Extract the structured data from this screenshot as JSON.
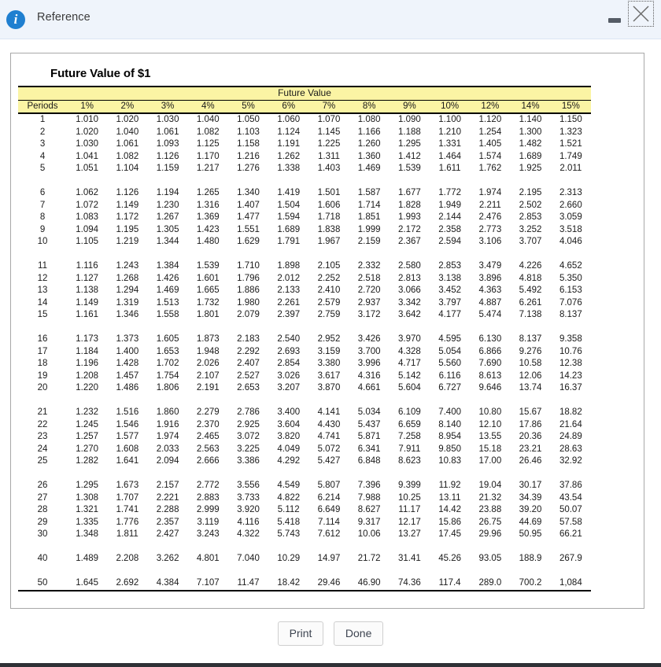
{
  "window": {
    "title": "Reference",
    "info_icon": "info-icon",
    "minimize_icon": "minimize-icon",
    "close_icon": "close-icon"
  },
  "content": {
    "table_title": "Future Value of $1",
    "banner_label": "Future Value",
    "period_header": "Periods",
    "rate_headers": [
      "1%",
      "2%",
      "3%",
      "4%",
      "5%",
      "6%",
      "7%",
      "8%",
      "9%",
      "10%",
      "12%",
      "14%",
      "15%"
    ],
    "accent_header_color": "#fbf4a4"
  },
  "footer": {
    "print_label": "Print",
    "done_label": "Done"
  },
  "chart_data": {
    "type": "table",
    "title": "Future Value of $1",
    "banner": "Future Value",
    "columns": [
      "Periods",
      "1%",
      "2%",
      "3%",
      "4%",
      "5%",
      "6%",
      "7%",
      "8%",
      "9%",
      "10%",
      "12%",
      "14%",
      "15%"
    ],
    "groups": [
      [
        [
          "1",
          "1.010",
          "1.020",
          "1.030",
          "1.040",
          "1.050",
          "1.060",
          "1.070",
          "1.080",
          "1.090",
          "1.100",
          "1.120",
          "1.140",
          "1.150"
        ],
        [
          "2",
          "1.020",
          "1.040",
          "1.061",
          "1.082",
          "1.103",
          "1.124",
          "1.145",
          "1.166",
          "1.188",
          "1.210",
          "1.254",
          "1.300",
          "1.323"
        ],
        [
          "3",
          "1.030",
          "1.061",
          "1.093",
          "1.125",
          "1.158",
          "1.191",
          "1.225",
          "1.260",
          "1.295",
          "1.331",
          "1.405",
          "1.482",
          "1.521"
        ],
        [
          "4",
          "1.041",
          "1.082",
          "1.126",
          "1.170",
          "1.216",
          "1.262",
          "1.311",
          "1.360",
          "1.412",
          "1.464",
          "1.574",
          "1.689",
          "1.749"
        ],
        [
          "5",
          "1.051",
          "1.104",
          "1.159",
          "1.217",
          "1.276",
          "1.338",
          "1.403",
          "1.469",
          "1.539",
          "1.611",
          "1.762",
          "1.925",
          "2.011"
        ]
      ],
      [
        [
          "6",
          "1.062",
          "1.126",
          "1.194",
          "1.265",
          "1.340",
          "1.419",
          "1.501",
          "1.587",
          "1.677",
          "1.772",
          "1.974",
          "2.195",
          "2.313"
        ],
        [
          "7",
          "1.072",
          "1.149",
          "1.230",
          "1.316",
          "1.407",
          "1.504",
          "1.606",
          "1.714",
          "1.828",
          "1.949",
          "2.211",
          "2.502",
          "2.660"
        ],
        [
          "8",
          "1.083",
          "1.172",
          "1.267",
          "1.369",
          "1.477",
          "1.594",
          "1.718",
          "1.851",
          "1.993",
          "2.144",
          "2.476",
          "2.853",
          "3.059"
        ],
        [
          "9",
          "1.094",
          "1.195",
          "1.305",
          "1.423",
          "1.551",
          "1.689",
          "1.838",
          "1.999",
          "2.172",
          "2.358",
          "2.773",
          "3.252",
          "3.518"
        ],
        [
          "10",
          "1.105",
          "1.219",
          "1.344",
          "1.480",
          "1.629",
          "1.791",
          "1.967",
          "2.159",
          "2.367",
          "2.594",
          "3.106",
          "3.707",
          "4.046"
        ]
      ],
      [
        [
          "11",
          "1.116",
          "1.243",
          "1.384",
          "1.539",
          "1.710",
          "1.898",
          "2.105",
          "2.332",
          "2.580",
          "2.853",
          "3.479",
          "4.226",
          "4.652"
        ],
        [
          "12",
          "1.127",
          "1.268",
          "1.426",
          "1.601",
          "1.796",
          "2.012",
          "2.252",
          "2.518",
          "2.813",
          "3.138",
          "3.896",
          "4.818",
          "5.350"
        ],
        [
          "13",
          "1.138",
          "1.294",
          "1.469",
          "1.665",
          "1.886",
          "2.133",
          "2.410",
          "2.720",
          "3.066",
          "3.452",
          "4.363",
          "5.492",
          "6.153"
        ],
        [
          "14",
          "1.149",
          "1.319",
          "1.513",
          "1.732",
          "1.980",
          "2.261",
          "2.579",
          "2.937",
          "3.342",
          "3.797",
          "4.887",
          "6.261",
          "7.076"
        ],
        [
          "15",
          "1.161",
          "1.346",
          "1.558",
          "1.801",
          "2.079",
          "2.397",
          "2.759",
          "3.172",
          "3.642",
          "4.177",
          "5.474",
          "7.138",
          "8.137"
        ]
      ],
      [
        [
          "16",
          "1.173",
          "1.373",
          "1.605",
          "1.873",
          "2.183",
          "2.540",
          "2.952",
          "3.426",
          "3.970",
          "4.595",
          "6.130",
          "8.137",
          "9.358"
        ],
        [
          "17",
          "1.184",
          "1.400",
          "1.653",
          "1.948",
          "2.292",
          "2.693",
          "3.159",
          "3.700",
          "4.328",
          "5.054",
          "6.866",
          "9.276",
          "10.76"
        ],
        [
          "18",
          "1.196",
          "1.428",
          "1.702",
          "2.026",
          "2.407",
          "2.854",
          "3.380",
          "3.996",
          "4.717",
          "5.560",
          "7.690",
          "10.58",
          "12.38"
        ],
        [
          "19",
          "1.208",
          "1.457",
          "1.754",
          "2.107",
          "2.527",
          "3.026",
          "3.617",
          "4.316",
          "5.142",
          "6.116",
          "8.613",
          "12.06",
          "14.23"
        ],
        [
          "20",
          "1.220",
          "1.486",
          "1.806",
          "2.191",
          "2.653",
          "3.207",
          "3.870",
          "4.661",
          "5.604",
          "6.727",
          "9.646",
          "13.74",
          "16.37"
        ]
      ],
      [
        [
          "21",
          "1.232",
          "1.516",
          "1.860",
          "2.279",
          "2.786",
          "3.400",
          "4.141",
          "5.034",
          "6.109",
          "7.400",
          "10.80",
          "15.67",
          "18.82"
        ],
        [
          "22",
          "1.245",
          "1.546",
          "1.916",
          "2.370",
          "2.925",
          "3.604",
          "4.430",
          "5.437",
          "6.659",
          "8.140",
          "12.10",
          "17.86",
          "21.64"
        ],
        [
          "23",
          "1.257",
          "1.577",
          "1.974",
          "2.465",
          "3.072",
          "3.820",
          "4.741",
          "5.871",
          "7.258",
          "8.954",
          "13.55",
          "20.36",
          "24.89"
        ],
        [
          "24",
          "1.270",
          "1.608",
          "2.033",
          "2.563",
          "3.225",
          "4.049",
          "5.072",
          "6.341",
          "7.911",
          "9.850",
          "15.18",
          "23.21",
          "28.63"
        ],
        [
          "25",
          "1.282",
          "1.641",
          "2.094",
          "2.666",
          "3.386",
          "4.292",
          "5.427",
          "6.848",
          "8.623",
          "10.83",
          "17.00",
          "26.46",
          "32.92"
        ]
      ],
      [
        [
          "26",
          "1.295",
          "1.673",
          "2.157",
          "2.772",
          "3.556",
          "4.549",
          "5.807",
          "7.396",
          "9.399",
          "11.92",
          "19.04",
          "30.17",
          "37.86"
        ],
        [
          "27",
          "1.308",
          "1.707",
          "2.221",
          "2.883",
          "3.733",
          "4.822",
          "6.214",
          "7.988",
          "10.25",
          "13.11",
          "21.32",
          "34.39",
          "43.54"
        ],
        [
          "28",
          "1.321",
          "1.741",
          "2.288",
          "2.999",
          "3.920",
          "5.112",
          "6.649",
          "8.627",
          "11.17",
          "14.42",
          "23.88",
          "39.20",
          "50.07"
        ],
        [
          "29",
          "1.335",
          "1.776",
          "2.357",
          "3.119",
          "4.116",
          "5.418",
          "7.114",
          "9.317",
          "12.17",
          "15.86",
          "26.75",
          "44.69",
          "57.58"
        ],
        [
          "30",
          "1.348",
          "1.811",
          "2.427",
          "3.243",
          "4.322",
          "5.743",
          "7.612",
          "10.06",
          "13.27",
          "17.45",
          "29.96",
          "50.95",
          "66.21"
        ]
      ],
      [
        [
          "40",
          "1.489",
          "2.208",
          "3.262",
          "4.801",
          "7.040",
          "10.29",
          "14.97",
          "21.72",
          "31.41",
          "45.26",
          "93.05",
          "188.9",
          "267.9"
        ]
      ],
      [
        [
          "50",
          "1.645",
          "2.692",
          "4.384",
          "7.107",
          "11.47",
          "18.42",
          "29.46",
          "46.90",
          "74.36",
          "117.4",
          "289.0",
          "700.2",
          "1,084"
        ]
      ]
    ]
  }
}
